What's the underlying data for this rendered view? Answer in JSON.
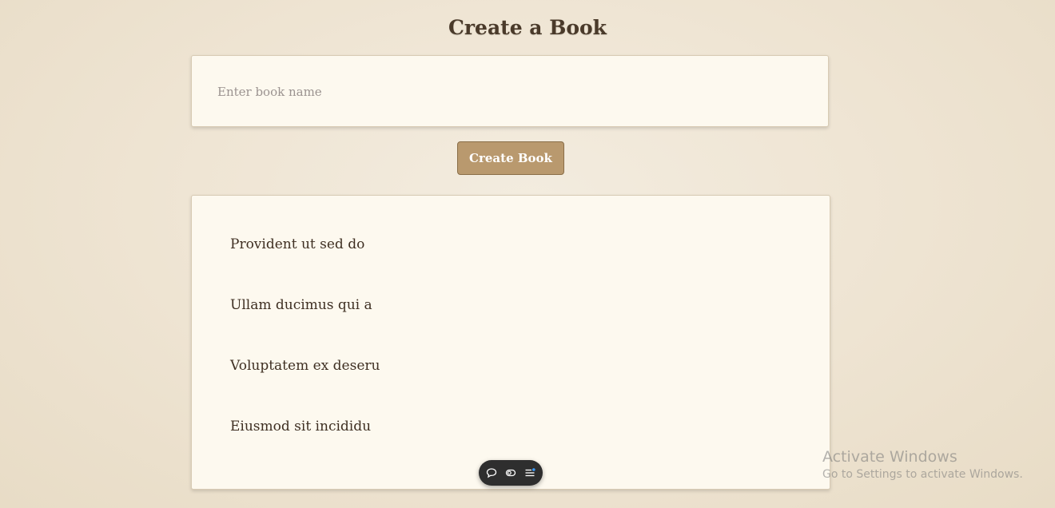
{
  "page": {
    "title": "Create a Book"
  },
  "form": {
    "input_placeholder": "Enter book name",
    "input_value": "",
    "button_label": "Create Book"
  },
  "books": [
    {
      "name": "Provident ut sed do"
    },
    {
      "name": "Ullam ducimus qui a"
    },
    {
      "name": "Voluptatem ex deseru"
    },
    {
      "name": "Eiusmod sit incididu"
    }
  ],
  "toolbar": {
    "icons": [
      "chat-bubble-icon",
      "toggle-icon",
      "menu-list-icon"
    ]
  },
  "watermark": {
    "title": "Activate Windows",
    "subtitle": "Go to Settings to activate Windows."
  },
  "colors": {
    "accent": "#b9996e",
    "card_background": "#fdf9ef",
    "page_background": "#efe5d4",
    "text": "#3e2f22"
  }
}
